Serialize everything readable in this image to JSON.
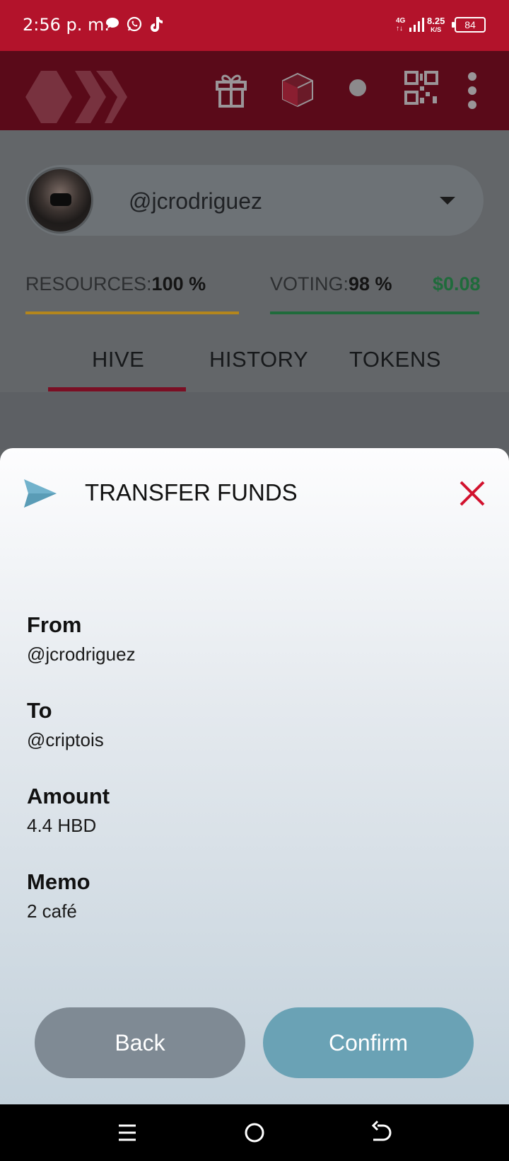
{
  "status_bar": {
    "time": "2:56 p. m.",
    "network": "4G",
    "speed_value": "8.25",
    "speed_unit": "K/S",
    "battery": "84",
    "notification_icons": [
      "chat-bubble-icon",
      "whatsapp-icon",
      "tiktok-icon"
    ]
  },
  "app_bar": {
    "icons": [
      "hive-logo-icon",
      "gift-icon",
      "cube-icon",
      "dot-icon",
      "qr-code-icon",
      "more-vert-icon"
    ]
  },
  "account": {
    "username": "@jcrodriguez"
  },
  "resources": {
    "resources_label": "RESOURCES:",
    "resources_value": "100 %",
    "voting_label": "VOTING:",
    "voting_value": "98 %",
    "vote_value": "$0.08",
    "resources_fill": 1.0,
    "voting_fill": 0.98
  },
  "tabs": [
    {
      "label": "HIVE",
      "active": true
    },
    {
      "label": "HISTORY",
      "active": false
    },
    {
      "label": "TOKENS",
      "active": false
    }
  ],
  "modal": {
    "title": "TRANSFER FUNDS",
    "fields": [
      {
        "label": "From",
        "value": "@jcrodriguez"
      },
      {
        "label": "To",
        "value": "@criptois"
      },
      {
        "label": "Amount",
        "value": "4.4 HBD"
      },
      {
        "label": "Memo",
        "value": "2 café"
      }
    ],
    "back_label": "Back",
    "confirm_label": "Confirm"
  },
  "colors": {
    "status_bar": "#b3132b",
    "accent_red": "#d2122e",
    "send_icon": "#72b2cc",
    "resources_bar": "#b4861c",
    "voting_bar": "#1f6b3b",
    "back_button": "#7f8a94",
    "confirm_button": "#6aa2b5"
  }
}
